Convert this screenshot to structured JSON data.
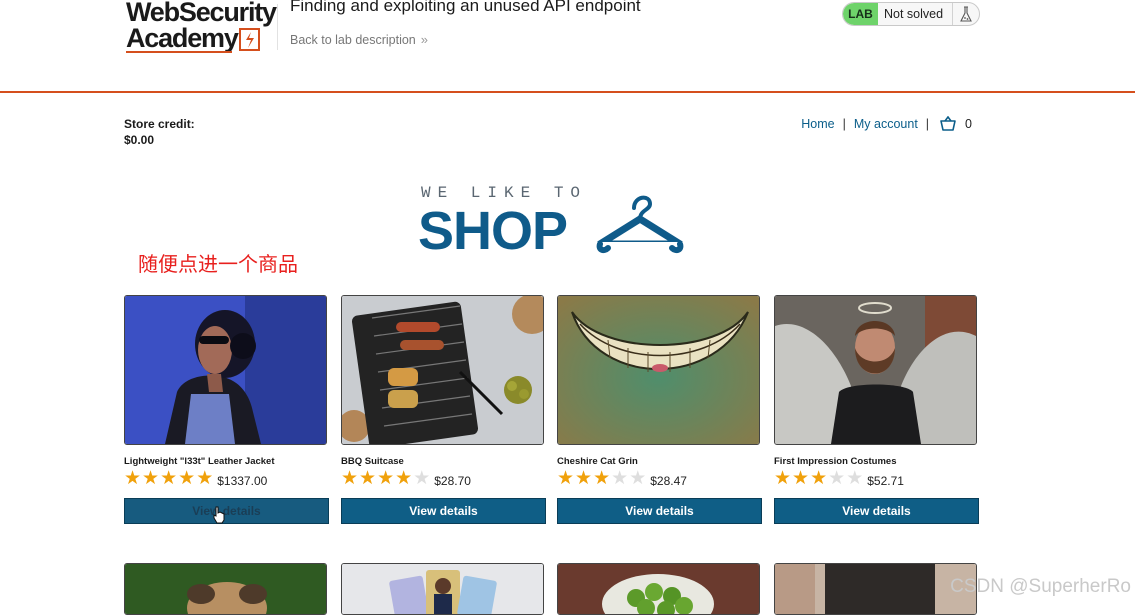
{
  "header": {
    "logo_line1": "WebSecurity",
    "logo_line2": "Academy",
    "lab_title": "Finding and exploiting an unused API endpoint",
    "back_link": "Back to lab description",
    "lab_badge": "LAB",
    "lab_status": "Not solved"
  },
  "store": {
    "credit_label": "Store credit:",
    "credit_value": "$0.00",
    "nav": {
      "home": "Home",
      "sep": "|",
      "account": "My account",
      "cart_count": "0"
    }
  },
  "hero": {
    "small": "WE LIKE TO",
    "big": "SHOP"
  },
  "annotation": "随便点进一个商品",
  "products": [
    {
      "name": "Lightweight \"l33t\" Leather Jacket",
      "rating": 5,
      "price": "$1337.00",
      "button": "View details"
    },
    {
      "name": "BBQ Suitcase",
      "rating": 4,
      "price": "$28.70",
      "button": "View details"
    },
    {
      "name": "Cheshire Cat Grin",
      "rating": 3,
      "price": "$28.47",
      "button": "View details"
    },
    {
      "name": "First Impression Costumes",
      "rating": 3,
      "price": "$52.71",
      "button": "View details"
    }
  ],
  "watermark": "CSDN @SuperherRo",
  "colors": {
    "accent": "#d54f1d",
    "brand_blue": "#0f5e86",
    "lab_green": "#6ed36a",
    "star": "#f0a10c",
    "annotation_red": "#e8201e"
  },
  "icons": [
    "logo-lightning-icon",
    "chevrons-right-icon",
    "flask-icon",
    "cart-icon",
    "hanger-icon",
    "star-icon",
    "mouse-cursor-icon"
  ]
}
